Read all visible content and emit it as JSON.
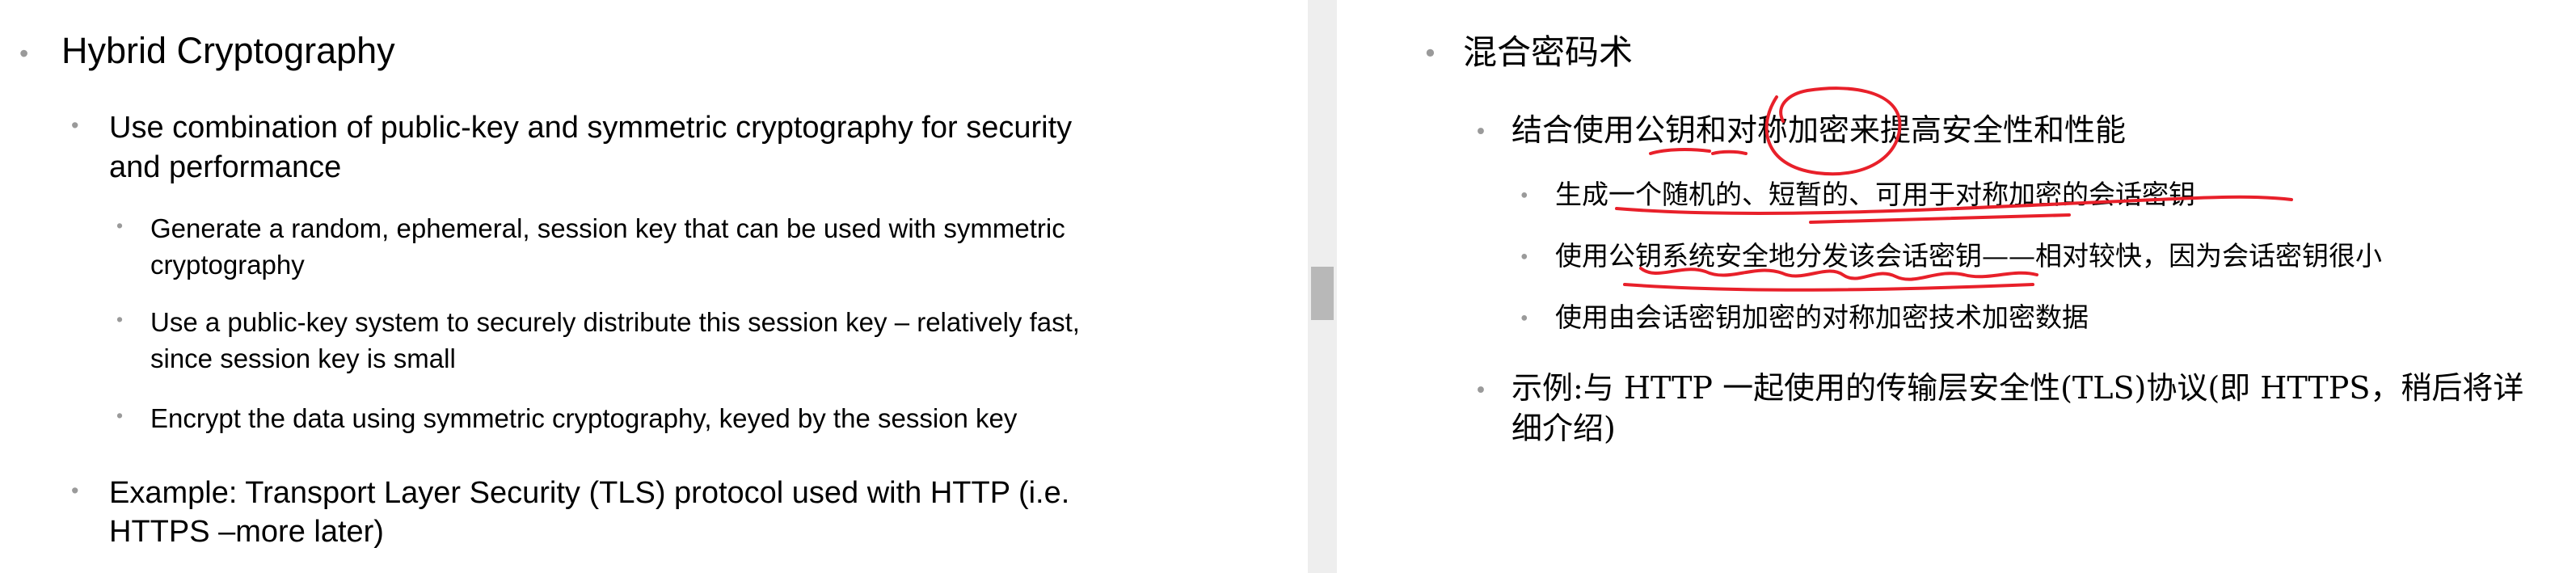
{
  "left": {
    "title": "Hybrid Cryptography",
    "point1_line1": "Use combination of public-key and symmetric cryptography for security",
    "point1_line2": "and performance",
    "sub1_line1": "Generate a random, ephemeral, session key that can be used with symmetric",
    "sub1_line2": "cryptography",
    "sub2_line1": "Use a public-key system to securely distribute this session key – relatively fast,",
    "sub2_line2": "since session key is small",
    "sub3": "Encrypt the data using symmetric cryptography, keyed by the session key",
    "point2_line1": "Example: Transport Layer Security (TLS) protocol used with HTTP (i.e.",
    "point2_line2": "HTTPS –more later)"
  },
  "right": {
    "title": "混合密码术",
    "point1": "结合使用公钥和对称加密来提高安全性和性能",
    "sub1": "生成一个随机的、短暂的、可用于对称加密的会话密钥",
    "sub2": "使用公钥系统安全地分发该会话密钥——相对较快，因为会话密钥很小",
    "sub3": "使用由会话密钥加密的对称加密技术加密数据",
    "point2_line1": "示例:与 HTTP 一起使用的传输层安全性(TLS)协议(即 HTTPS，稍后将详",
    "point2_line2": "细介绍)"
  },
  "bullet_glyph": "•",
  "colors": {
    "bullet": "#9a9a9a",
    "annotation_ink": "#e8202a",
    "gutter": "#eeeeee",
    "scroll_thumb": "#b8b8b8"
  }
}
